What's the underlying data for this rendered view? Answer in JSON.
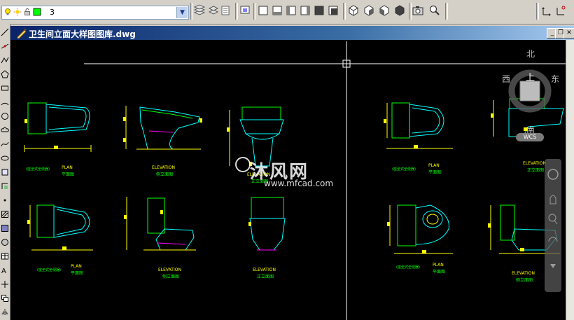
{
  "toolbar": {
    "layer_current": "3",
    "icons": [
      "bulb-icon",
      "sun-icon",
      "lock-icon",
      "color-swatch-icon",
      "dropdown-icon",
      "layer-manager-icon",
      "layer-previous-icon",
      "layer-states-icon",
      "view-icons",
      "zoom-icon",
      "pan-icon",
      "ucs-icon"
    ]
  },
  "window": {
    "title": "卫生间立面大样图图库.dwg",
    "buttons": {
      "minimize": "_",
      "restore": "❐",
      "close": "✕"
    }
  },
  "viewcube": {
    "north": "北",
    "south": "南",
    "east": "东",
    "west": "西",
    "top_face": "上",
    "wcs": "WCS"
  },
  "drawing": {
    "labels": [
      {
        "id": "plan-1",
        "title": "PLAN",
        "sub": "平面图",
        "note": "(座坐式坐便器)"
      },
      {
        "id": "elev-1",
        "title": "ELEVATION",
        "sub": "侧立面图"
      },
      {
        "id": "elev-2",
        "title": "ELEVATION",
        "sub": "正立面图"
      },
      {
        "id": "plan-2",
        "title": "PLAN",
        "sub": "平面图",
        "note": "(座坐式坐便器)"
      },
      {
        "id": "elev-3",
        "title": "ELEVATION",
        "sub": "正立面图"
      },
      {
        "id": "plan-3",
        "title": "PLAN",
        "sub": "平面图",
        "note": "(座坐式坐便器)"
      },
      {
        "id": "elev-4",
        "title": "ELEVATION",
        "sub": "侧立面图"
      },
      {
        "id": "elev-5",
        "title": "ELEVATION",
        "sub": "正立面图"
      },
      {
        "id": "plan-4",
        "title": "PLAN",
        "sub": "平面图",
        "note": "(座坐式坐便器)"
      },
      {
        "id": "elev-6",
        "title": "ELEVATION",
        "sub": "侧立面图"
      }
    ],
    "watermark": "沐风网",
    "watermark_url": "www.mfcad.com"
  },
  "colors": {
    "background": "#000000",
    "cyan": "#00ffff",
    "yellow": "#ffff00",
    "green": "#00ff00",
    "magenta": "#ff00ff",
    "title_bar": "#0a246a"
  }
}
